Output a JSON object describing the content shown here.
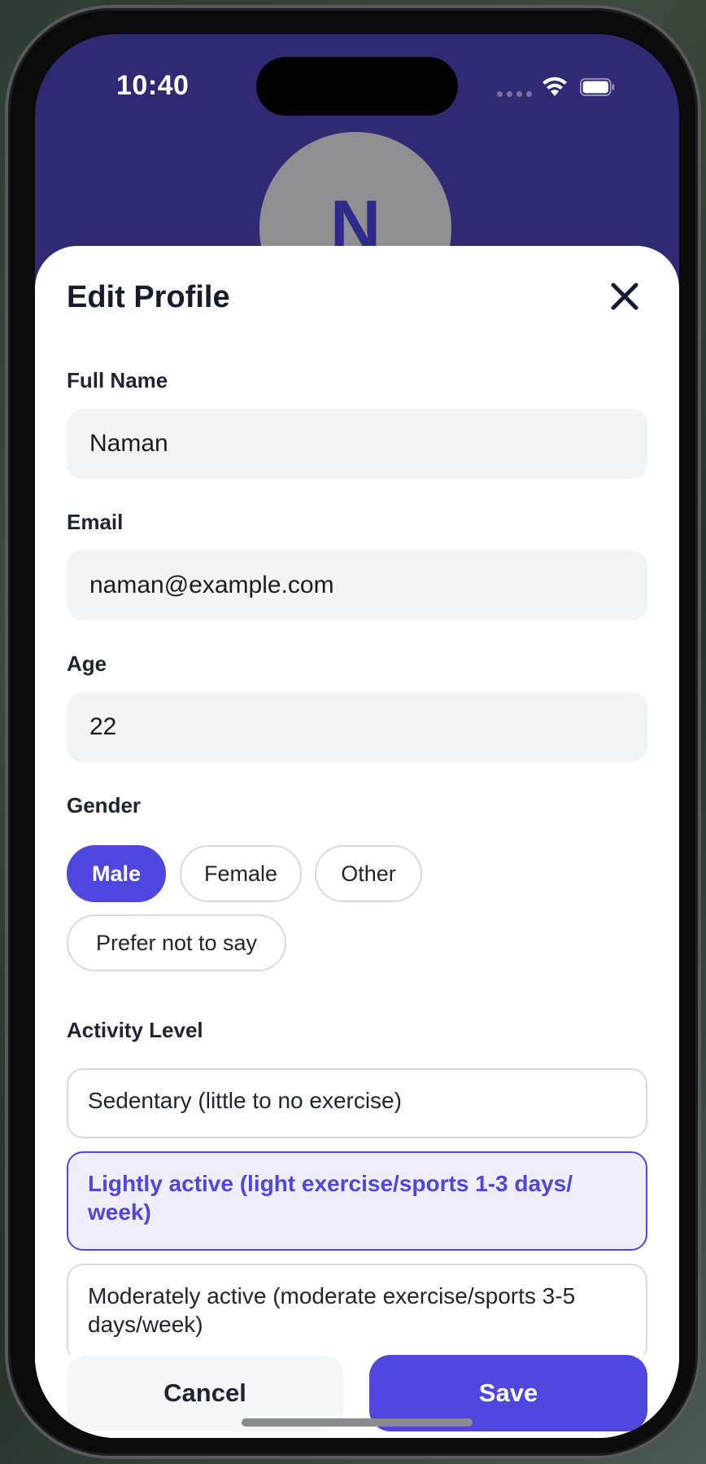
{
  "status_bar": {
    "time": "10:40",
    "wifi_icon": "wifi-icon",
    "battery_icon": "battery-icon"
  },
  "avatar": {
    "initial": "N",
    "background_color": "#8f8f91",
    "text_color": "#2e2a8a"
  },
  "header_background_color": "#302a74",
  "sheet": {
    "title": "Edit Profile",
    "close_icon": "close-icon"
  },
  "form": {
    "full_name": {
      "label": "Full Name",
      "value": "Naman"
    },
    "email": {
      "label": "Email",
      "value": "naman@example.com"
    },
    "age": {
      "label": "Age",
      "value": "22"
    },
    "gender": {
      "label": "Gender",
      "options": [
        "Male",
        "Female",
        "Other",
        "Prefer not to say"
      ],
      "selected": "Male"
    },
    "activity_level": {
      "label": "Activity Level",
      "options": [
        "Sedentary (little to no exercise)",
        "Lightly active (light exercise/sports 1-3 days/ week)",
        "Moderately active (moderate exercise/sports 3-5 days/week)"
      ],
      "selected": "Lightly active (light exercise/sports 1-3 days/ week)"
    }
  },
  "footer": {
    "cancel_label": "Cancel",
    "save_label": "Save"
  },
  "colors": {
    "accent": "#4f46e0",
    "accent_light": "#f0eefc",
    "input_background": "#f2f3f5",
    "text_primary": "#141c2e"
  }
}
